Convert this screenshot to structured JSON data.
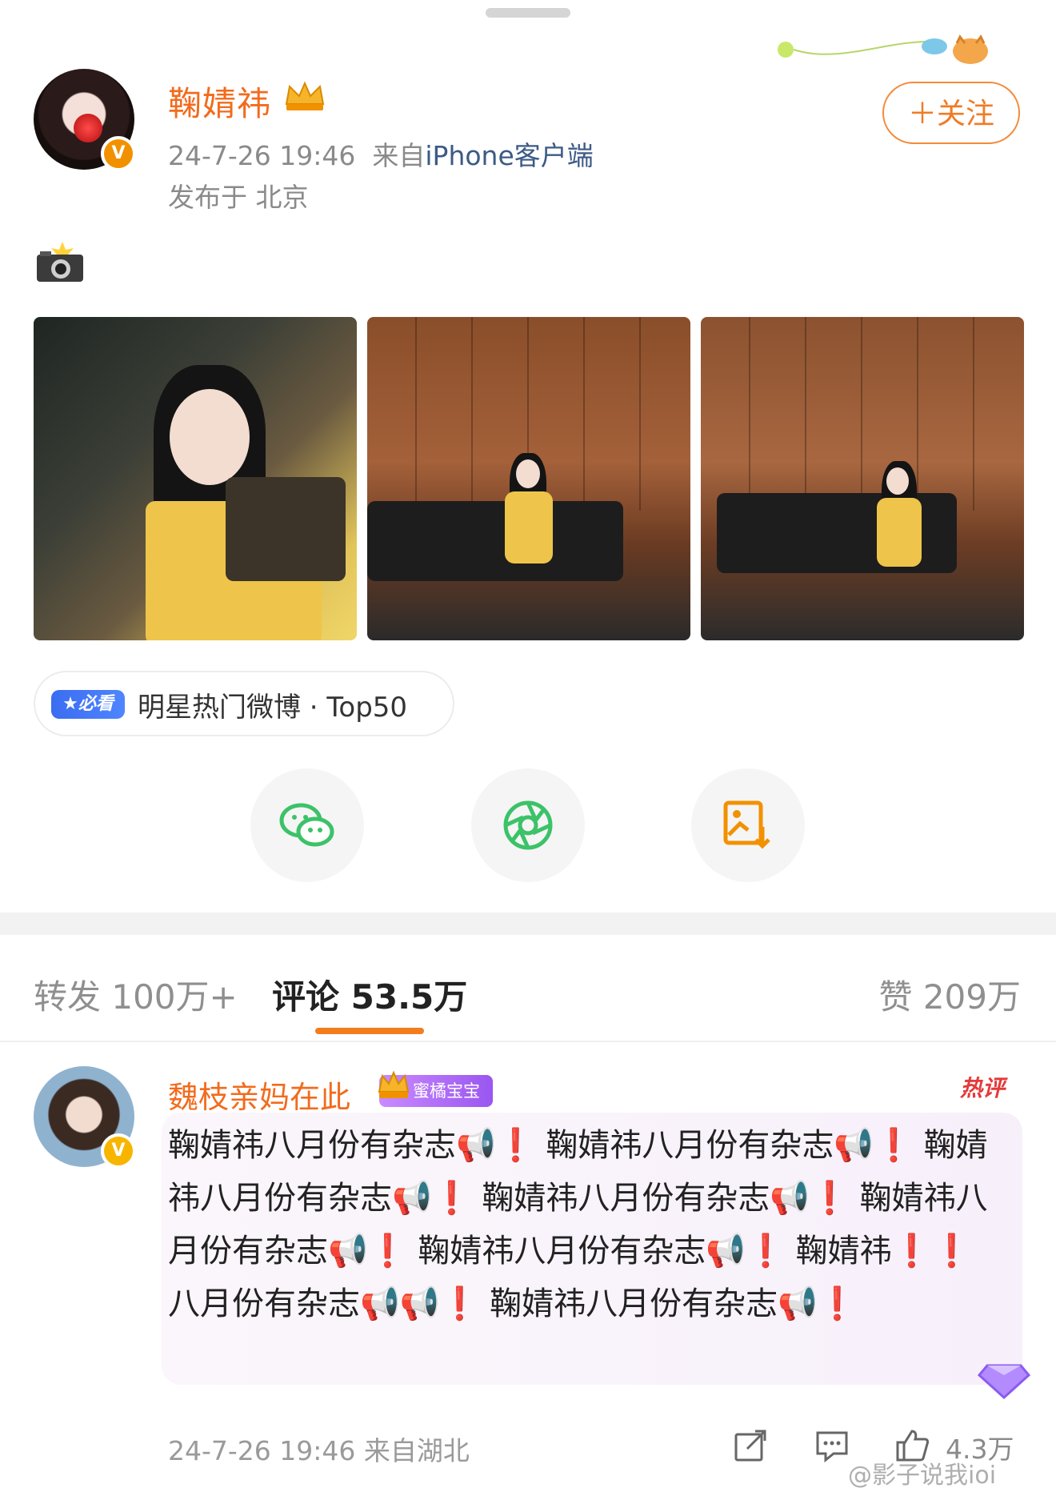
{
  "post": {
    "author": "鞠婧祎",
    "time": "24-7-26 19:46",
    "source_prefix": "来自",
    "source": "iPhone客户端",
    "location": "发布于 北京",
    "follow_label": "＋关注",
    "content_icon": "camera-flash-emoji"
  },
  "hot_badge": {
    "tag": "★必看",
    "text": "明星热门微博 · Top50"
  },
  "share": [
    "wechat-icon",
    "moments-icon",
    "save-image-icon"
  ],
  "tabs": {
    "repost": "转发 100万+",
    "comments": "评论 53.5万",
    "likes": "赞 209万"
  },
  "comment": {
    "author": "魏枝亲妈在此",
    "fan_badge": "蜜橘宝宝",
    "hot_label": "热评",
    "text": "鞠婧祎八月份有杂志📢❗ 鞠婧祎八月份有杂志📢❗ 鞠婧祎八月份有杂志📢❗ 鞠婧祎八月份有杂志📢❗ 鞠婧祎八月份有杂志📢❗ 鞠婧祎八月份有杂志📢❗ 鞠婧祎❗❗ 八月份有杂志📢📢❗ 鞠婧祎八月份有杂志📢❗",
    "footer": "24-7-26 19:46  来自湖北",
    "like_count": "4.3万"
  },
  "watermark": "@影子说我ioi",
  "colors": {
    "accent_orange": "#f26b1d",
    "link_blue": "#3c5a86",
    "badge_blue": "#3a6df0"
  }
}
